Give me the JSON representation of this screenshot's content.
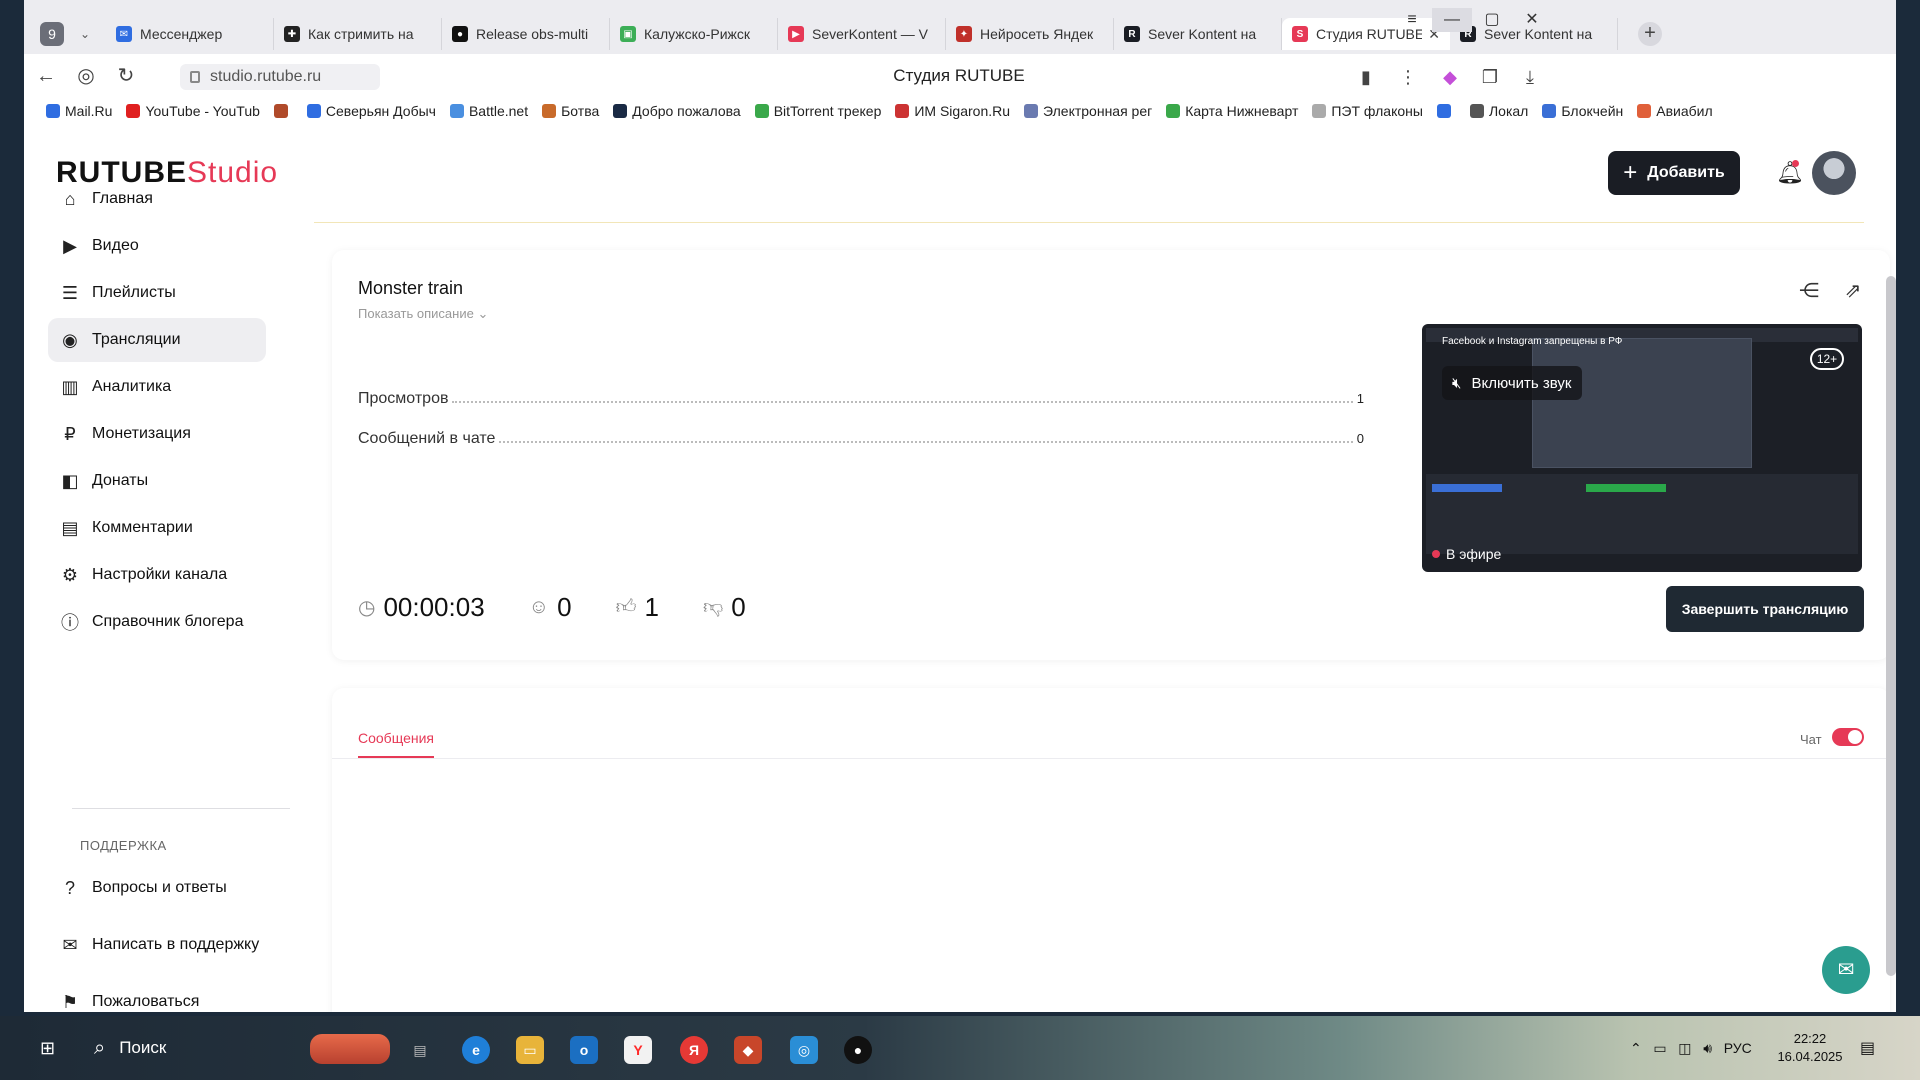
{
  "browser": {
    "tab_count": "9",
    "tabs": [
      {
        "label": "Мессенджер",
        "color": "#2f6de1",
        "glyph": "✉"
      },
      {
        "label": "Как стримить на",
        "color": "#222222",
        "glyph": "✚"
      },
      {
        "label": "Release obs-multi",
        "color": "#111111",
        "glyph": "●"
      },
      {
        "label": "Калужско-Рижск",
        "color": "#3cae57",
        "glyph": "▣"
      },
      {
        "label": "SeverKontent — V",
        "color": "#e63956",
        "glyph": "▶"
      },
      {
        "label": "Нейросеть Яндек",
        "color": "#c0302a",
        "glyph": "✦"
      },
      {
        "label": "Sever Kontent на",
        "color": "#1a1d24",
        "glyph": "R"
      },
      {
        "label": "Студия RUTUBE",
        "color": "#e63956",
        "glyph": "S",
        "active": true
      },
      {
        "label": "Sever Kontent на",
        "color": "#1a1d24",
        "glyph": "R"
      }
    ],
    "url": "studio.rutube.ru",
    "page_title": "Студия RUTUBE",
    "bookmarks": [
      {
        "label": "Mail.Ru",
        "color": "#2f6de1"
      },
      {
        "label": "YouTube - YouTub",
        "color": "#e02020"
      },
      {
        "label": "",
        "color": "#b04a2a"
      },
      {
        "label": "Северьян Добыч",
        "color": "#2f6de1"
      },
      {
        "label": "Battle.net",
        "color": "#4a8fe0"
      },
      {
        "label": "Ботва",
        "color": "#c86a2a"
      },
      {
        "label": "Добро пожалова",
        "color": "#1a2a44"
      },
      {
        "label": "BitTorrent трекер",
        "color": "#3aa84a"
      },
      {
        "label": "ИМ Sigaron.Ru",
        "color": "#cc3333"
      },
      {
        "label": "Электронная рег",
        "color": "#6a7ab0"
      },
      {
        "label": "Карта Нижневарт",
        "color": "#3aa84a"
      },
      {
        "label": "ПЭТ флаконы",
        "color": "#aaaaaa"
      },
      {
        "label": "",
        "color": "#2f6de1"
      },
      {
        "label": "Локал",
        "color": "#555555"
      },
      {
        "label": "Блокчейн",
        "color": "#3a6fd6"
      },
      {
        "label": "Авиабил",
        "color": "#e0603a"
      }
    ]
  },
  "header": {
    "logo_main": "RUTUBE",
    "logo_sub": "Studio",
    "add_button": "Добавить"
  },
  "sidebar": {
    "items": [
      {
        "label": "Главная",
        "icon": "⌂"
      },
      {
        "label": "Видео",
        "icon": "▶"
      },
      {
        "label": "Плейлисты",
        "icon": "☰"
      },
      {
        "label": "Трансляции",
        "icon": "◉"
      },
      {
        "label": "Аналитика",
        "icon": "▥"
      },
      {
        "label": "Монетизация",
        "icon": "₽"
      },
      {
        "label": "Донаты",
        "icon": "◧"
      },
      {
        "label": "Комментарии",
        "icon": "▤"
      },
      {
        "label": "Настройки канала",
        "icon": "⚙"
      },
      {
        "label": "Справочник блогера",
        "icon": "ⓘ"
      }
    ],
    "support_section": "ПОДДЕРЖКА",
    "support_items": [
      {
        "label": "Вопросы и ответы",
        "icon": "?"
      },
      {
        "label": "Написать в поддержку",
        "icon": "✉"
      },
      {
        "label": "Пожаловаться",
        "icon": "⚑"
      }
    ]
  },
  "stream": {
    "title": "Monster train",
    "show_description": "Показать описание",
    "stats": [
      {
        "label": "Просмотров",
        "value": "1"
      },
      {
        "label": "Сообщений в чате",
        "value": "0"
      }
    ],
    "player": {
      "news_text": "Facebook и Instagram запрещены в РФ",
      "unmute_label": "Включить звук",
      "age_rating": "12+",
      "live_label": "В эфире"
    },
    "metrics": {
      "duration": "00:00:03",
      "viewers": "0",
      "likes": "1",
      "dislikes": "0"
    },
    "end_button": "Завершить трансляцию"
  },
  "chat": {
    "tab_messages": "Сообщения",
    "chat_label": "Чат",
    "chat_enabled": true
  },
  "taskbar": {
    "search_label": "Поиск",
    "lang": "РУС",
    "time": "22:22",
    "date": "16.04.2025"
  },
  "colors": {
    "accent": "#e63956",
    "dark_button": "#1a1d24",
    "end_button": "#1f2933"
  }
}
